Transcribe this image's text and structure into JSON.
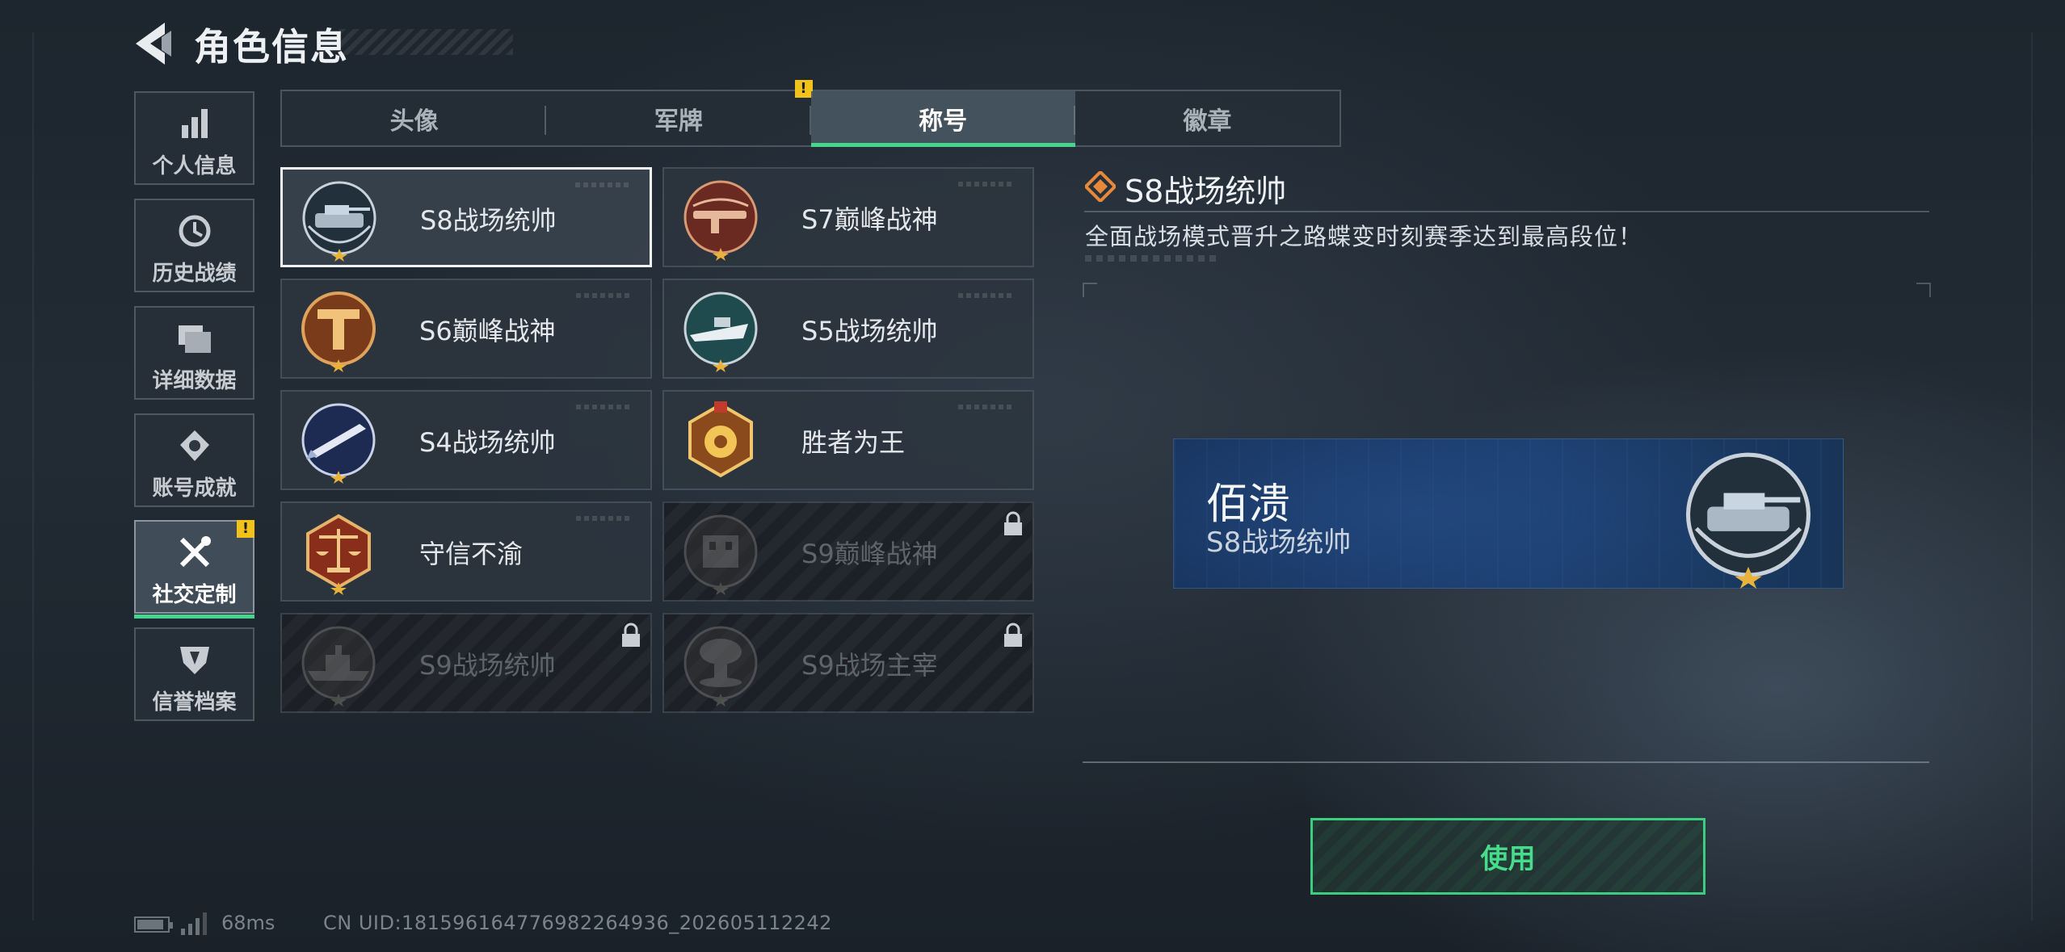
{
  "header": {
    "title": "角色信息"
  },
  "sidebar": {
    "items": [
      {
        "label": "个人信息",
        "icon": "bar-chart-icon"
      },
      {
        "label": "历史战绩",
        "icon": "clock-icon"
      },
      {
        "label": "详细数据",
        "icon": "folder-icon"
      },
      {
        "label": "账号成就",
        "icon": "medal-icon"
      },
      {
        "label": "社交定制",
        "icon": "tools-icon",
        "active": true,
        "alert": "!"
      },
      {
        "label": "信誉档案",
        "icon": "shield-icon"
      }
    ]
  },
  "tabs": [
    {
      "label": "头像"
    },
    {
      "label": "军牌",
      "alert": "!"
    },
    {
      "label": "称号",
      "active": true
    },
    {
      "label": "徽章"
    }
  ],
  "titles": [
    {
      "name": "S8战场统帅",
      "emblem": "tank-emblem-icon",
      "selected": true,
      "locked": false
    },
    {
      "name": "S7巅峰战神",
      "emblem": "rifle-emblem-icon",
      "locked": false
    },
    {
      "name": "S6巅峰战神",
      "emblem": "t-crest-emblem-icon",
      "locked": false
    },
    {
      "name": "S5战场统帅",
      "emblem": "boat-emblem-icon",
      "locked": false
    },
    {
      "name": "S4战场统帅",
      "emblem": "missile-emblem-icon",
      "locked": false
    },
    {
      "name": "胜者为王",
      "emblem": "medal-emblem-icon",
      "locked": false
    },
    {
      "name": "守信不渝",
      "emblem": "scales-emblem-icon",
      "locked": false
    },
    {
      "name": "S9巅峰战神",
      "emblem": "building-emblem-icon",
      "locked": true
    },
    {
      "name": "S9战场统帅",
      "emblem": "warship-emblem-icon",
      "locked": true
    },
    {
      "name": "S9战场主宰",
      "emblem": "mushroom-cloud-emblem-icon",
      "locked": true
    }
  ],
  "detail": {
    "title": "S8战场统帅",
    "description": "全面战场模式晋升之路蝶变时刻赛季达到最高段位！",
    "preview": {
      "player_name": "佰溃",
      "title_name": "S8战场统帅"
    },
    "use_label": "使用"
  },
  "status": {
    "ping": "68ms",
    "uid": "CN UID:1815961647769822649​36_202605112242"
  },
  "colors": {
    "accent_green": "#45d58c",
    "alert_yellow": "#f0c21a",
    "preview_blue": "#1b3d6c",
    "diamond_orange": "#e8893a"
  }
}
